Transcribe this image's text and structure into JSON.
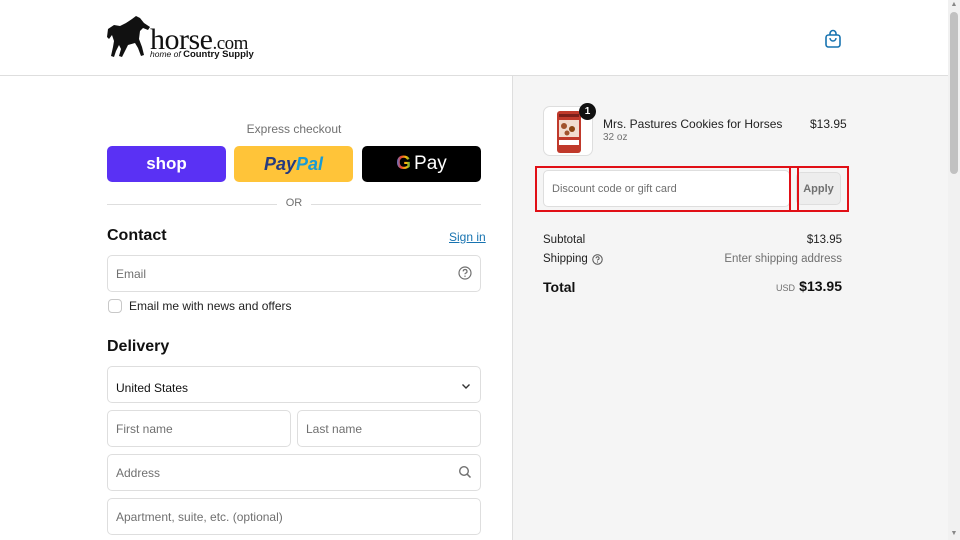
{
  "header": {
    "logo_word": "horse",
    "logo_dotcom": ".com",
    "logo_tag_prefix": "home of",
    "logo_tag_brand": "Country Supply",
    "cart_icon": "shopping-bag-icon"
  },
  "express": {
    "title": "Express checkout",
    "shop_label": "shop",
    "paypal_label_1": "Pay",
    "paypal_label_2": "Pal",
    "gpay_g": "G",
    "gpay_label": "Pay",
    "or_label": "OR"
  },
  "contact": {
    "title": "Contact",
    "signin_label": "Sign in",
    "email_placeholder": "Email",
    "newsletter_label": "Email me with news and offers"
  },
  "delivery": {
    "title": "Delivery",
    "country": "United States",
    "first_name_placeholder": "First name",
    "last_name_placeholder": "Last name",
    "address_placeholder": "Address",
    "apartment_placeholder": "Apartment, suite, etc. (optional)"
  },
  "summary": {
    "product_name": "Mrs. Pastures Cookies for Horses",
    "product_variant": "32 oz",
    "product_qty": "1",
    "product_price": "$13.95",
    "discount_placeholder": "Discount code or gift card",
    "apply_label": "Apply",
    "subtotal_label": "Subtotal",
    "subtotal_value": "$13.95",
    "shipping_label": "Shipping",
    "shipping_value": "Enter shipping address",
    "total_label": "Total",
    "total_currency": "USD",
    "total_value": "$13.95"
  },
  "colors": {
    "shop_purple": "#5a31f4",
    "paypal_yellow": "#ffc439",
    "link_blue": "#1773b0",
    "highlight_red": "#e10f16"
  }
}
